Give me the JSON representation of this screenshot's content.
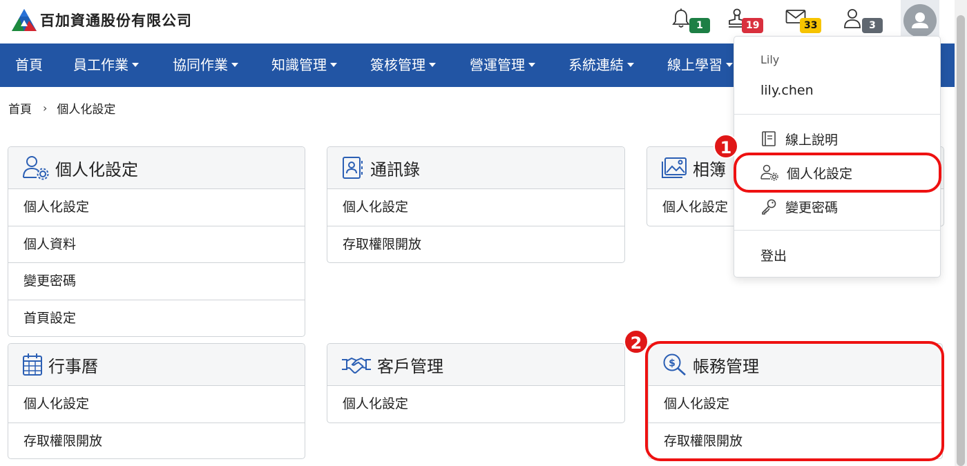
{
  "header": {
    "company_name": "百加資通股份有限公司",
    "notifications": [
      {
        "icon": "bell-icon",
        "count": "1",
        "color": "#1d7f45"
      },
      {
        "icon": "stamp-icon",
        "count": "19",
        "color": "#d9303e"
      },
      {
        "icon": "mail-icon",
        "count": "33",
        "color": "#f7c400"
      },
      {
        "icon": "user-icon",
        "count": "3",
        "color": "#5f6770"
      }
    ],
    "avatar_icon": "avatar-icon"
  },
  "nav": {
    "items": [
      {
        "label": "首頁",
        "has_dropdown": false
      },
      {
        "label": "員工作業",
        "has_dropdown": true
      },
      {
        "label": "協同作業",
        "has_dropdown": true
      },
      {
        "label": "知識管理",
        "has_dropdown": true
      },
      {
        "label": "簽核管理",
        "has_dropdown": true
      },
      {
        "label": "營運管理",
        "has_dropdown": true
      },
      {
        "label": "系統連結",
        "has_dropdown": true
      },
      {
        "label": "線上學習",
        "has_dropdown": true
      }
    ],
    "background": "#2255a4"
  },
  "breadcrumb": {
    "home": "首頁",
    "current": "個人化設定"
  },
  "cards": [
    {
      "title": "個人化設定",
      "icon": "user-gear-icon",
      "items": [
        "個人化設定",
        "個人資料",
        "變更密碼",
        "首頁設定"
      ]
    },
    {
      "title": "通訊錄",
      "icon": "address-book-icon",
      "items": [
        "個人化設定",
        "存取權限開放"
      ]
    },
    {
      "title": "相簿",
      "icon": "photo-album-icon",
      "items": [
        "個人化設定"
      ]
    },
    {
      "title": "行事曆",
      "icon": "calendar-icon",
      "items": [
        "個人化設定",
        "存取權限開放"
      ]
    },
    {
      "title": "客戶管理",
      "icon": "handshake-icon",
      "items": [
        "個人化設定"
      ]
    },
    {
      "title": "帳務管理",
      "icon": "money-search-icon",
      "items": [
        "個人化設定",
        "存取權限開放"
      ]
    }
  ],
  "user_menu": {
    "name": "Lily",
    "account": "lily.chen",
    "items": [
      {
        "label": "線上說明",
        "icon": "book-icon"
      },
      {
        "label": "個人化設定",
        "icon": "user-gear-icon"
      },
      {
        "label": "變更密碼",
        "icon": "key-icon"
      },
      {
        "label": "登出",
        "icon": ""
      }
    ]
  },
  "annotations": [
    {
      "number": "1",
      "color": "#ee1111"
    },
    {
      "number": "2",
      "color": "#ee1111"
    }
  ]
}
